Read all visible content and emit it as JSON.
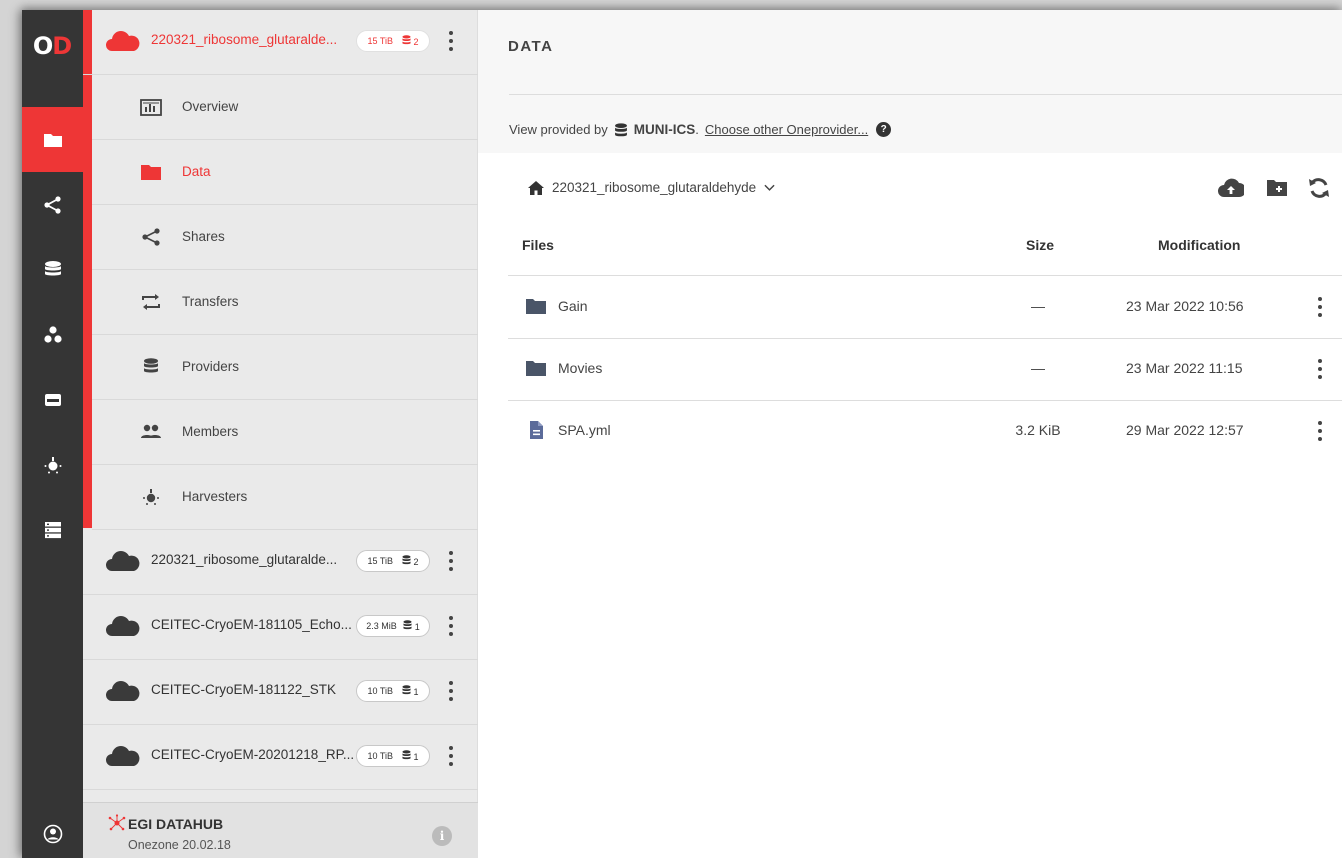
{
  "logo": {
    "letter_o": "O",
    "letter_d": "D"
  },
  "rail": {
    "items": [
      "folder-icon",
      "share-icon",
      "database-icon",
      "groups-icon",
      "cluster-icon",
      "harvester-icon",
      "server-icon"
    ],
    "active_index": 0,
    "bottom_icon": "user-icon"
  },
  "sidebar": {
    "selected_space": {
      "name": "220321_ribosome_glutaralde...",
      "size": "15 TiB",
      "providers": "2"
    },
    "subnav": [
      {
        "label": "Overview",
        "icon": "overview-icon"
      },
      {
        "label": "Data",
        "icon": "folder-icon"
      },
      {
        "label": "Shares",
        "icon": "share-icon"
      },
      {
        "label": "Transfers",
        "icon": "transfer-icon"
      },
      {
        "label": "Providers",
        "icon": "database-icon"
      },
      {
        "label": "Members",
        "icon": "members-icon"
      },
      {
        "label": "Harvesters",
        "icon": "harvester-icon"
      }
    ],
    "spaces": [
      {
        "name": "220321_ribosome_glutaralde...",
        "size": "15 TiB",
        "providers": "2"
      },
      {
        "name": "CEITEC-CryoEM-181105_Echo...",
        "size": "2.3 MiB",
        "providers": "1"
      },
      {
        "name": "CEITEC-CryoEM-181122_STK",
        "size": "10 TiB",
        "providers": "1"
      },
      {
        "name": "CEITEC-CryoEM-20201218_RP...",
        "size": "10 TiB",
        "providers": "1"
      }
    ],
    "footer": {
      "title": "EGI DATAHUB",
      "version": "Onezone 20.02.18",
      "info": "i"
    }
  },
  "main": {
    "title": "DATA",
    "provided_prefix": "View provided by",
    "provider_name": "MUNI-ICS",
    "provider_suffix": ".",
    "choose_link": "Choose other Oneprovider...",
    "help": "?",
    "breadcrumb": "220321_ribosome_glutaraldehyde",
    "columns": {
      "files": "Files",
      "size": "Size",
      "modification": "Modification"
    },
    "files": [
      {
        "name": "Gain",
        "type": "folder",
        "size": "—",
        "modified": "23 Mar 2022 10:56"
      },
      {
        "name": "Movies",
        "type": "folder",
        "size": "—",
        "modified": "23 Mar 2022 11:15"
      },
      {
        "name": "SPA.yml",
        "type": "file",
        "size": "3.2 KiB",
        "modified": "29 Mar 2022 12:57"
      }
    ]
  },
  "colors": {
    "accent": "#ee3636",
    "rail": "#353535",
    "sidebar": "#eaeaea",
    "folder": "#4a5568",
    "file": "#5b6b9a"
  }
}
